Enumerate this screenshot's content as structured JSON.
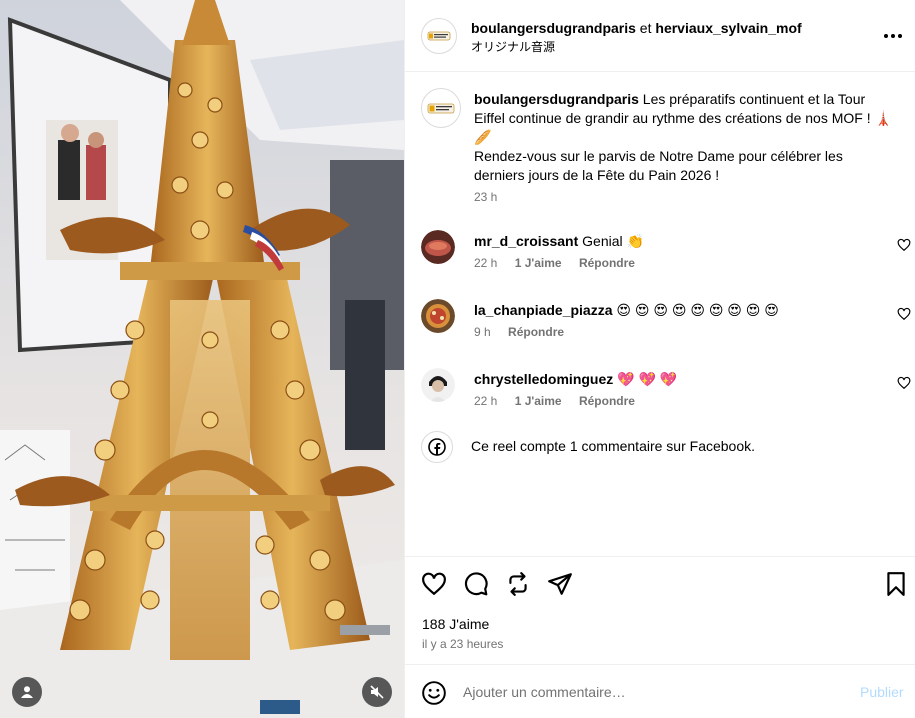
{
  "post": {
    "authors_primary": "boulangersdugrandparis",
    "authors_connector": " et ",
    "authors_secondary": "herviaux_sylvain_mof",
    "audio_label": "オリジナル音源"
  },
  "caption": {
    "username": "boulangersdugrandparis",
    "text_line1": " Les préparatifs continuent et la Tour Eiffel continue de grandir au rythme des créations de nos MOF ! 🗼🥖",
    "text_line2": "Rendez-vous sur le parvis de Notre Dame pour célébrer les derniers jours de la Fête du Pain 2026 !",
    "time": "23 h"
  },
  "comments": [
    {
      "username": "mr_d_croissant",
      "text": " Genial 👏",
      "time": "22 h",
      "likes": "1 J'aime",
      "reply": "Répondre",
      "avatar_color": "#7a3b2e"
    },
    {
      "username": "la_chanpiade_piazza",
      "text": " 😍 😍 😍 😍 😍 😍 😍 😍 😍",
      "time": "9 h",
      "likes": "",
      "reply": "Répondre",
      "avatar_color": "#b06a2a"
    },
    {
      "username": "chrystelledominguez",
      "text": " 💖 💖 💖",
      "time": "22 h",
      "likes": "1 J'aime",
      "reply": "Répondre",
      "avatar_color": "#e8e8e8"
    }
  ],
  "facebook_note": "Ce reel compte 1 commentaire sur Facebook.",
  "actions": {
    "like_count": "188 J'aime",
    "posted": "il y a 23 heures"
  },
  "composer": {
    "placeholder": "Ajouter un commentaire…",
    "publish_label": "Publier"
  },
  "icons": {
    "more": "more-horizontal-icon",
    "like": "heart-icon",
    "comment": "comment-bubble-icon",
    "repost": "repost-icon",
    "share": "send-icon",
    "save": "bookmark-icon",
    "emoji": "emoji-icon",
    "facebook": "facebook-icon",
    "user": "user-tag-icon",
    "mute": "muted-speaker-icon"
  },
  "colors": {
    "secondary_text": "#737373",
    "publish_disabled": "#b3dbff",
    "divider": "#efefef"
  }
}
